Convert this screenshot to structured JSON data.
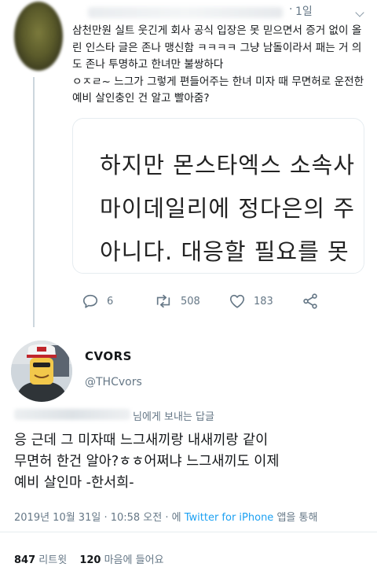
{
  "parent_tweet": {
    "time": "1일",
    "text": "삼천만원 실트 웃긴게 회사 공식 입장은 못 믿으면서 증거 없이 올린 인스타 글은 존나 맹신함 ㅋㅋㅋㅋ 그냥 남돌이라서 패는 거 의도 존나 투명하고 한녀만 불쌍하다\nㅇㅈㄹ~ 느그가 그렇게 편들어주는 한녀 미자 때 무면허로 운전한 예비 살인충인 건 알고 빨아줌?",
    "media_lines": [
      "하지만 몬스타엑스 소속사",
      "마이데일리에 정다은의 주",
      "아니다. 대응할 필요를 못"
    ],
    "actions": {
      "reply_count": "6",
      "retweet_count": "508",
      "like_count": "183"
    }
  },
  "main_tweet": {
    "display_name": "CVORS",
    "handle": "@THCvors",
    "reply_to_suffix": "님에게 보내는 답글",
    "text": "응 근데 그 미자때 느그새끼랑 내새끼랑 같이\n무면허 한건 알아?ㅎㅎ어쩌냐 느그새끼도 이제\n예비 살인마 -한서희-",
    "meta_time": "2019년 10월 31일 · 10:58 오전 · 에 ",
    "meta_client": "Twitter for iPhone",
    "meta_suffix": " 앱을 통해",
    "retweet_count": "847",
    "retweet_label": "리트윗",
    "like_count": "120",
    "like_label": "마음에 들어요"
  },
  "colors": {
    "text_primary": "#14171a",
    "text_secondary": "#657786",
    "link": "#1da1f2",
    "border": "#e6ecf0"
  },
  "icons": [
    "reply-icon",
    "retweet-icon",
    "like-icon",
    "share-icon",
    "chevron-down-icon"
  ]
}
